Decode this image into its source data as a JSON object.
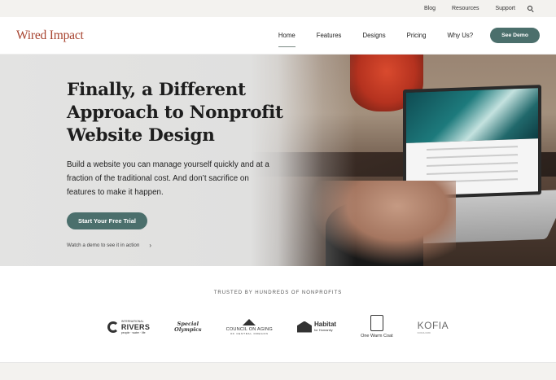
{
  "utility_nav": {
    "blog": "Blog",
    "resources": "Resources",
    "support": "Support"
  },
  "main_nav": {
    "logo": "Wired Impact",
    "links": [
      "Home",
      "Features",
      "Designs",
      "Pricing",
      "Why Us?"
    ],
    "active": "Home",
    "demo_button": "See Demo"
  },
  "hero": {
    "title_line1": "Finally, a Different",
    "title_line2": "Approach to Nonprofit",
    "title_line3": "Website Design",
    "description": "Build a website you can manage yourself quickly and at a fraction of the traditional cost. And don’t sacrifice on features to make it happen.",
    "cta_label": "Start Your Free Trial",
    "watch_label": "Watch a demo to see it in action",
    "watch_chevron": "›"
  },
  "trust": {
    "title": "TRUSTED BY HUNDREDS OF NONPROFITS",
    "orgs": {
      "rivers_top": "INTERNATIONAL",
      "rivers_word": "RIVERS",
      "rivers_sub": "people · water · life",
      "special_top": "Special",
      "special_bottom": "Olympics",
      "council_word": "COUNCIL ON AGING",
      "council_sub": "OF CENTRAL OREGON",
      "habitat_word": "Habitat",
      "habitat_sub": "for Humanity",
      "coat_word": "One Warm Coat",
      "kofia_word": "KOFIA",
      "kofia_sub": "KOFIA CRD"
    }
  },
  "colors": {
    "brand_red": "#a7432f",
    "button_teal": "#4b6f6c"
  },
  "icons": {
    "search": "search-icon"
  }
}
